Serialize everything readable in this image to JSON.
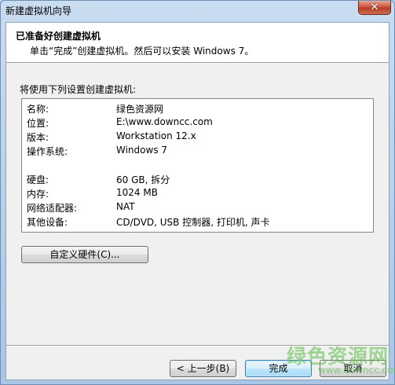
{
  "window": {
    "title": "新建虚拟机向导",
    "close_glyph": "✕"
  },
  "header": {
    "title": "已准备好创建虚拟机",
    "subtitle": "单击“完成”创建虚拟机。然后可以安装 Windows 7。"
  },
  "intro": "将使用下列设置创建虚拟机:",
  "summary": {
    "rows": [
      {
        "label": "名称:",
        "value": "绿色资源网"
      },
      {
        "label": "位置:",
        "value": "E:\\www.downcc.com"
      },
      {
        "label": "版本:",
        "value": "Workstation 12.x"
      },
      {
        "label": "操作系统:",
        "value": "Windows 7"
      },
      {
        "label": "硬盘:",
        "value": "60 GB, 拆分"
      },
      {
        "label": "内存:",
        "value": "1024 MB"
      },
      {
        "label": "网络适配器:",
        "value": "NAT"
      },
      {
        "label": "其他设备:",
        "value": "CD/DVD, USB 控制器, 打印机, 声卡"
      }
    ]
  },
  "buttons": {
    "customize": "自定义硬件(C)...",
    "back": "< 上一步(B)",
    "finish": "完成",
    "cancel": "取消"
  },
  "watermark": {
    "cn": "绿色资源网",
    "en": "www.downcc.com"
  },
  "colors": {
    "titlebar": "#b9d1ea",
    "finish_border": "#3c7fb1",
    "close_button": "#c9503b"
  }
}
